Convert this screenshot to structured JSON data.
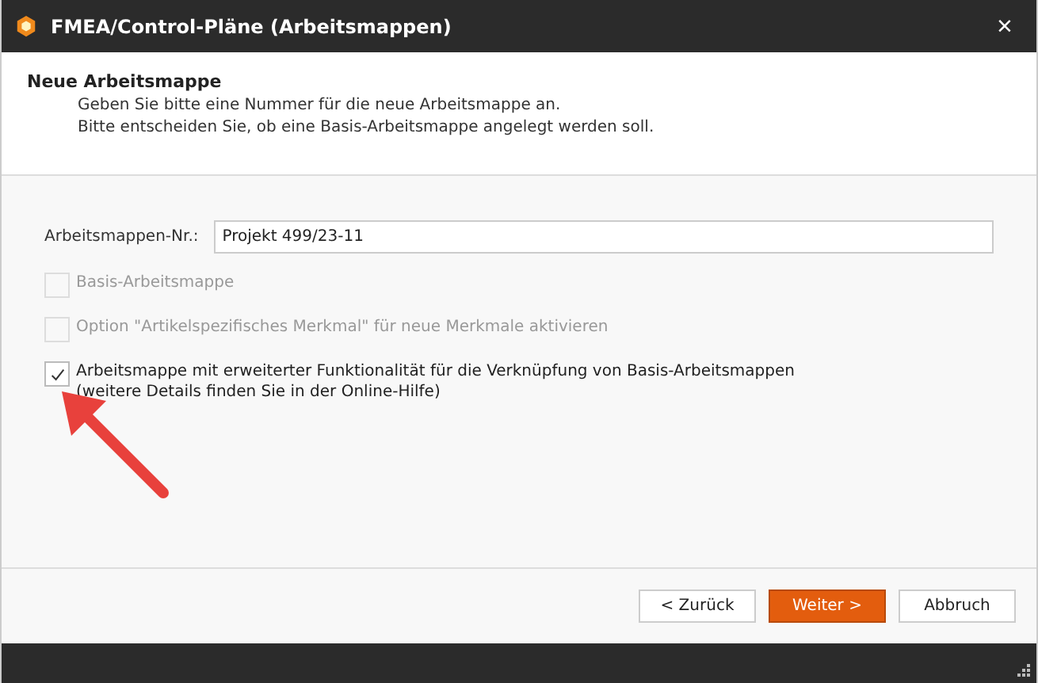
{
  "window": {
    "title": "FMEA/Control-Pläne (Arbeitsmappen)",
    "close": "×"
  },
  "header": {
    "title": "Neue Arbeitsmappe",
    "lines": [
      "Geben Sie bitte eine Nummer für die neue Arbeitsmappe an.",
      "Bitte entscheiden Sie, ob eine Basis-Arbeitsmappe angelegt werden soll."
    ]
  },
  "field": {
    "label": "Arbeitsmappen-Nr.:",
    "value": "Projekt 499/23-11"
  },
  "options": [
    {
      "lines": [
        "Basis-Arbeitsmappe"
      ],
      "checked": false,
      "disabled": true
    },
    {
      "lines": [
        "Option \"Artikelspezifisches Merkmal\" für neue Merkmale aktivieren"
      ],
      "checked": false,
      "disabled": true
    },
    {
      "lines": [
        "Arbeitsmappe mit erweiterter Funktionalität für die Verknüpfung von Basis-Arbeitsmappen",
        "(weitere Details finden Sie in der Online-Hilfe)"
      ],
      "checked": true,
      "disabled": false
    }
  ],
  "buttons": [
    {
      "label": "< Zurück",
      "kind": "normal"
    },
    {
      "label": "Weiter >",
      "kind": "primary"
    },
    {
      "label": "Abbruch",
      "kind": "normal"
    }
  ]
}
